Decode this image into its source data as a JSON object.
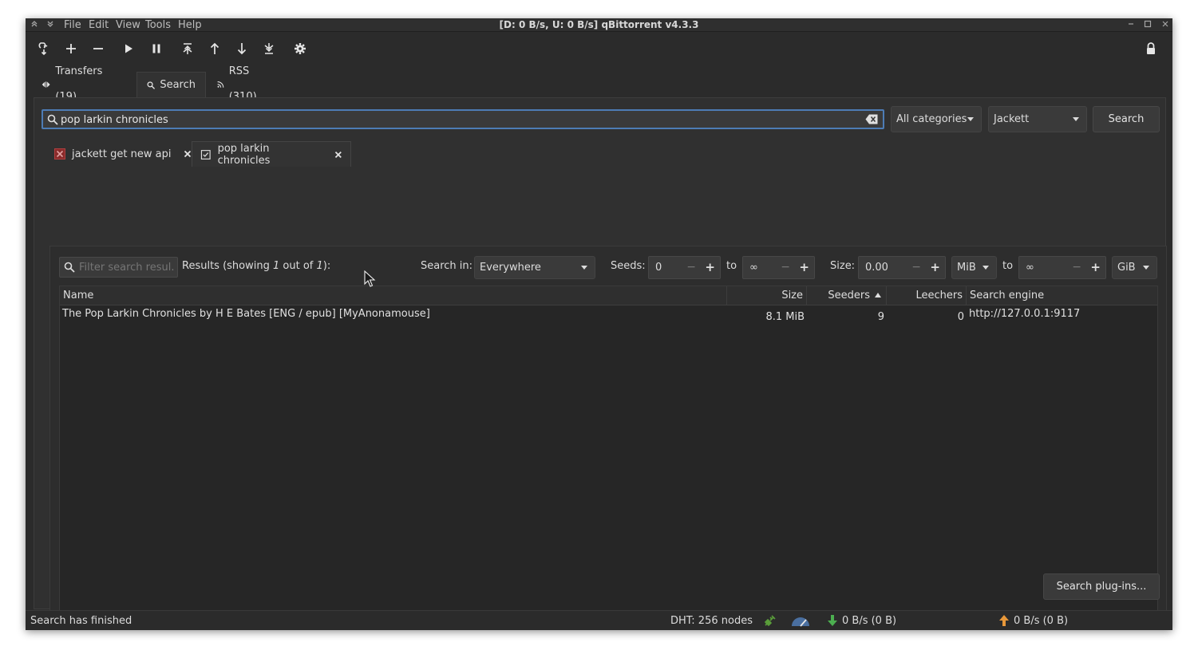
{
  "window": {
    "title": "[D: 0 B/s, U: 0 B/s] qBittorrent v4.3.3",
    "menu": [
      "File",
      "Edit",
      "View",
      "Tools",
      "Help"
    ]
  },
  "toolbar": {
    "icons": [
      "link-icon",
      "add-icon",
      "remove-icon",
      "resume-icon",
      "pause-icon",
      "move-top-icon",
      "move-up-icon",
      "move-down-icon",
      "move-bottom-icon",
      "settings-icon",
      "lock-icon"
    ]
  },
  "main_tabs": [
    {
      "label": "Transfers (19)"
    },
    {
      "label": "Search"
    },
    {
      "label": "RSS (310)"
    }
  ],
  "search": {
    "query": "pop larkin chronicles",
    "category": "All categories",
    "plugin": "Jackett",
    "button": "Search"
  },
  "result_tabs": [
    {
      "label": "jackett get new api"
    },
    {
      "label": "pop larkin chronicles"
    }
  ],
  "filter": {
    "placeholder": "Filter search resul...",
    "results_prefix": "Results (showing ",
    "results_shown": "1",
    "results_mid": " out of ",
    "results_total": "1",
    "results_suffix": "):",
    "search_in_label": "Search in:",
    "search_in_value": "Everywhere",
    "seeds_label": "Seeds:",
    "seeds_min": "0",
    "to_label": "to",
    "seeds_max": "∞",
    "size_label": "Size:",
    "size_min": "0.00",
    "size_min_unit": "MiB",
    "size_max": "∞",
    "size_max_unit": "GiB"
  },
  "table": {
    "columns": [
      "Name",
      "Size",
      "Seeders",
      "Leechers",
      "Search engine"
    ],
    "rows": [
      {
        "name": "The Pop Larkin Chronicles by H E Bates [ENG / epub] [MyAnonamouse]",
        "size": "8.1 MiB",
        "seeders": "9",
        "leechers": "0",
        "engine": "http://127.0.0.1:9117"
      }
    ]
  },
  "plugins_button": "Search plug-ins...",
  "status": {
    "message": "Search has finished",
    "dht": "DHT: 256 nodes",
    "download": "0 B/s (0 B)",
    "upload": "0 B/s (0 B)"
  },
  "colors": {
    "window_bg": "#2b2b2b",
    "focus_border": "#4d7cb5",
    "connected_green": "#5a9e3a",
    "download_green": "#4caf50",
    "upload_orange": "#e8983a"
  }
}
